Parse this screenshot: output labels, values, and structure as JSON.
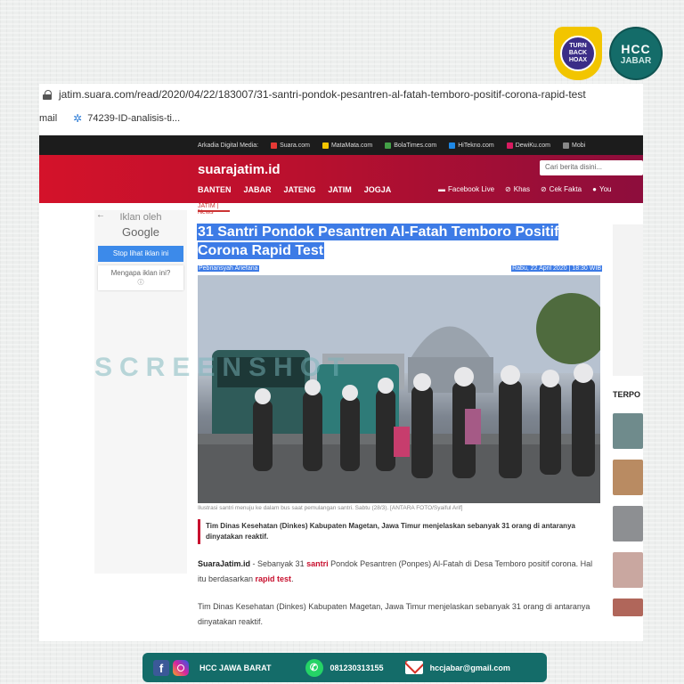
{
  "badges": {
    "turnbackhoax": "TURN BACK HOAX",
    "hcc_top": "HCC",
    "hcc_bottom": "JABAR"
  },
  "browser": {
    "url": "jatim.suara.com/read/2020/04/22/183007/31-santri-pondok-pesantren-al-fatah-temboro-positif-corona-rapid-test",
    "bookmarks": [
      "mail",
      "74239-ID-analisis-ti..."
    ]
  },
  "site": {
    "topline_label": "Arkadia Digital Media:",
    "media": [
      "Suara.com",
      "MataMata.com",
      "BolaTimes.com",
      "HiTekno.com",
      "DewiKu.com",
      "Mobi"
    ],
    "media_colors": [
      "#e53935",
      "#f2c500",
      "#43a047",
      "#1e88e5",
      "#d81b60",
      "#888888"
    ],
    "logo": "suarajatim.id",
    "search_placeholder": "Cari berita disini...",
    "nav": [
      "BANTEN",
      "JABAR",
      "JATENG",
      "JATIM",
      "JOGJA"
    ],
    "nav_right": [
      "Facebook Live",
      "Khas",
      "Cek Fakta",
      "You"
    ],
    "accent": "#c8102e"
  },
  "ad": {
    "back": "←",
    "by": "Iklan oleh",
    "google": "Google",
    "stop": "Stop lihat iklan ini",
    "why": "Mengapa iklan ini?",
    "info": "ⓘ"
  },
  "article": {
    "breadcrumb": "JATIM | News",
    "headline": "31 Santri Pondok Pesantren Al-Fatah Temboro Positif Corona Rapid Test",
    "author": "Pebriansyah Ariefana",
    "date": "Rabu, 22 April 2020 | 18:30 WIB",
    "caption": "Ilustrasi santri menuju ke dalam bus saat pemulangan santri. Sabtu (28/3). [ANTARA FOTO/Syaiful Arif]",
    "lead": "Tim Dinas Kesehatan (Dinkes) Kabupaten Magetan, Jawa Timur menjelaskan sebanyak 31 orang di antaranya dinyatakan reaktif.",
    "p1_source": "SuaraJatim.id",
    "p1_a": " - Sebanyak 31 ",
    "p1_link1": "santri",
    "p1_b": " Pondok Pesantren (Ponpes) Al-Fatah di Desa Temboro positif corona. Hal itu berdasarkan ",
    "p1_link2": "rapid test",
    "p1_c": ".",
    "p2": "Tim Dinas Kesehatan (Dinkes) Kabupaten Magetan, Jawa Timur menjelaskan sebanyak 31 orang di antaranya dinyatakan reaktif."
  },
  "sidebar": {
    "terpo": "TERPO"
  },
  "watermark": "SCREENSHOT",
  "footer": {
    "name": "HCC JAWA BARAT",
    "phone": "081230313155",
    "email": "hccjabar@gmail.com"
  }
}
